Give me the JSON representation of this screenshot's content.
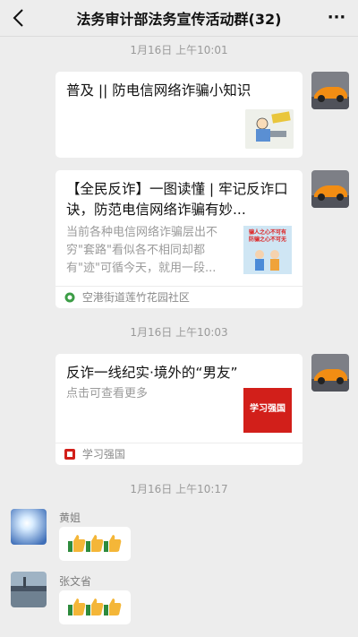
{
  "header": {
    "title": "法务审计部法务宣传活动群(32)",
    "back_icon": "back-chevron-icon",
    "more_label": "···"
  },
  "timestamps": [
    "1月16日 上午10:01",
    "1月16日 上午10:03",
    "1月16日 上午10:17"
  ],
  "messages": [
    {
      "type": "link",
      "title": "普及 || 防电信网络诈骗小知识",
      "thumb_icon": "anti-fraud-cartoon-image"
    },
    {
      "type": "article",
      "title": "【全民反诈】一图读懂 | 牢记反诈口诀，防范电信网络诈骗有妙...",
      "desc": "当前各种电信网络诈骗层出不穷\"套路\"看似各不相同却都有\"迹\"可循今天，就用一段...",
      "thumb_text_1": "骗人之心不可有",
      "thumb_text_2": "防骗之心不可无",
      "source": "空港街道莲竹花园社区"
    },
    {
      "type": "article",
      "title": "反诈一线纪实·境外的“男友”",
      "desc": "点击可查看更多",
      "thumb_logo_text": "学习强国",
      "source": "学习强国"
    }
  ],
  "replies": [
    {
      "name": "黄姐",
      "content": "thumbs-up x3"
    },
    {
      "name": "张文省",
      "content": "thumbs-up x3"
    }
  ],
  "colors": {
    "background": "#ededed",
    "bubble": "#ffffff",
    "xuexi_red": "#d21f1a",
    "timestamp": "#9a9a9a"
  }
}
